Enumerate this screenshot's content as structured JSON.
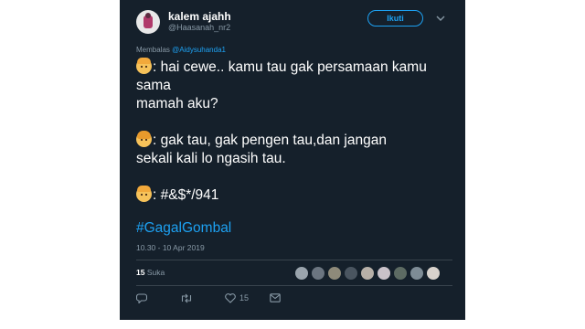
{
  "tweet": {
    "author": {
      "display_name": "kalem ajahh",
      "handle": "@Haasanah_nr2"
    },
    "follow_label": "Ikuti",
    "reply_label": "Membalas",
    "reply_to": "@Aidysuhanda1",
    "lines": [
      {
        "emoji": "man",
        "text": ": hai cewe.. kamu tau gak persamaan kamu"
      },
      {
        "emoji": null,
        "text": "sama"
      },
      {
        "emoji": null,
        "text": "mamah aku?"
      },
      {
        "emoji": "woman",
        "text": ": gak tau, gak pengen tau,dan jangan"
      },
      {
        "emoji": null,
        "text": "sekali kali lo ngasih tau."
      },
      {
        "emoji": "man",
        "text": ": #&$*/941"
      }
    ],
    "hashtag": "#GagalGombal",
    "timestamp": "10.30 - 10 Apr 2019",
    "likes_count": "15",
    "likes_label": "Suka",
    "liker_colors": [
      "#9aa4ad",
      "#6b7580",
      "#8e8a7a",
      "#4a5560",
      "#b7b0a8",
      "#c9c2c9",
      "#5d6b63",
      "#7e8c96",
      "#d8d2cc"
    ],
    "actions": {
      "like_count": "15"
    }
  }
}
